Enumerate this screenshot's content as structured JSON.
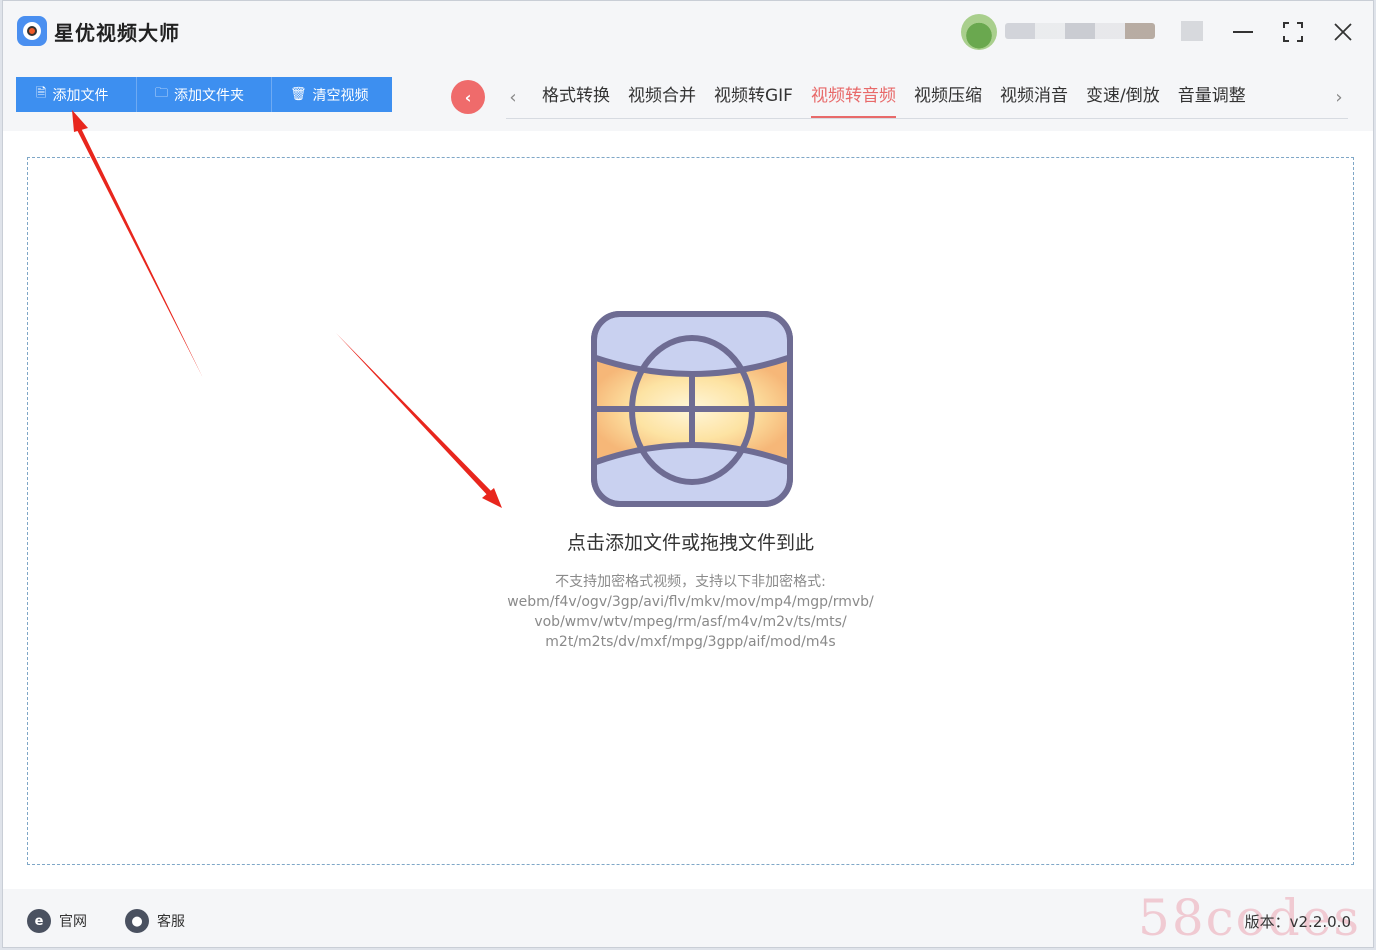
{
  "app": {
    "title": "星优视频大师",
    "accent_color": "#3d8ff0",
    "active_tab_color": "#e86a6a"
  },
  "window_controls": {
    "minimize_icon": "minimize-icon",
    "maximize_icon": "maximize-icon",
    "close_icon": "close-icon"
  },
  "toolbar": {
    "add_file_label": "添加文件",
    "add_folder_label": "添加文件夹",
    "clear_label": "清空视频"
  },
  "tabs": [
    {
      "label": "格式转换",
      "active": false
    },
    {
      "label": "视频合并",
      "active": false
    },
    {
      "label": "视频转GIF",
      "active": false
    },
    {
      "label": "视频转音频",
      "active": true
    },
    {
      "label": "视频压缩",
      "active": false
    },
    {
      "label": "视频消音",
      "active": false
    },
    {
      "label": "变速/倒放",
      "active": false
    },
    {
      "label": "音量调整",
      "active": false
    }
  ],
  "dropzone": {
    "title": "点击添加文件或拖拽文件到此",
    "hint_line1": "不支持加密格式视频，支持以下非加密格式:",
    "hint_line2": "webm/f4v/ogv/3gp/avi/flv/mkv/mov/mp4/mgp/rmvb/",
    "hint_line3": "vob/wmv/wtv/mpeg/rm/asf/m4v/m2v/ts/mts/",
    "hint_line4": "m2t/m2ts/dv/mxf/mpg/3gpp/aif/mod/m4s"
  },
  "footer": {
    "website_label": "官网",
    "support_label": "客服",
    "version_label": "版本：v2.2.0.0",
    "watermark": "58codes"
  },
  "annotations": {
    "arrow_color": "#e8261d"
  }
}
